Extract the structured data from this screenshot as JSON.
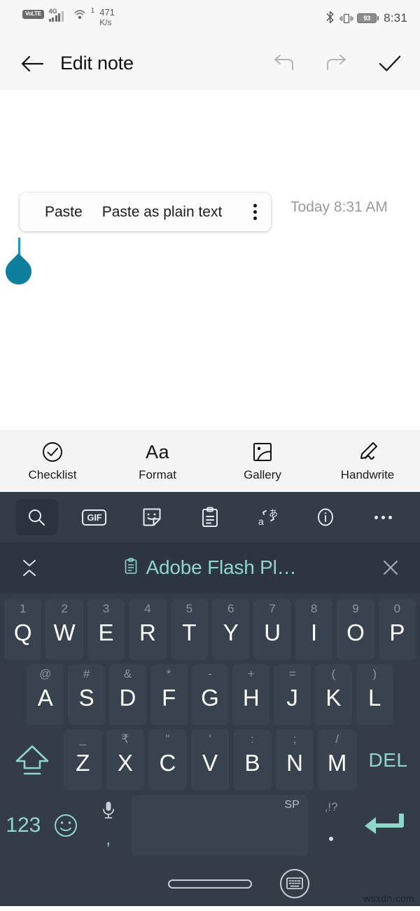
{
  "status_bar": {
    "volte": "VoLTE",
    "network_type": "4G",
    "hotspot_count": "1",
    "data_rate": "471",
    "data_rate_unit": "K/s",
    "bluetooth_icon": "bluetooth-icon",
    "vibrate_icon": "vibrate-icon",
    "battery_level": "93",
    "time": "8:31"
  },
  "app_bar": {
    "back_icon": "back-arrow-icon",
    "title": "Edit note",
    "undo_icon": "undo-icon",
    "redo_icon": "redo-icon",
    "done_icon": "checkmark-icon"
  },
  "editor": {
    "note_date": "Today 8:31 AM",
    "paste_menu": {
      "paste": "Paste",
      "paste_plain": "Paste as plain text",
      "overflow_icon": "more-vertical-icon"
    },
    "cursor_handle_color": "#0e7f9c",
    "caret_color": "#2196c4"
  },
  "format_toolbar": {
    "items": [
      {
        "label": "Checklist",
        "icon": "check-circle-icon"
      },
      {
        "label": "Format",
        "icon": "format-aa-icon",
        "glyph": "Aa"
      },
      {
        "label": "Gallery",
        "icon": "image-icon"
      },
      {
        "label": "Handwrite",
        "icon": "pencil-handwrite-icon"
      }
    ]
  },
  "keyboard": {
    "toolbar": [
      {
        "name": "search-icon",
        "label": "",
        "active": true
      },
      {
        "name": "gif-icon",
        "label": "GIF",
        "active": false
      },
      {
        "name": "sticker-icon",
        "label": "",
        "active": false
      },
      {
        "name": "clipboard-icon",
        "label": "",
        "active": false
      },
      {
        "name": "translate-icon",
        "label": "",
        "active": false
      },
      {
        "name": "info-icon",
        "label": "",
        "active": false
      },
      {
        "name": "more-horizontal-icon",
        "label": "",
        "active": false
      }
    ],
    "clipboard_suggestion": {
      "collapse_icon": "collapse-chevrons-icon",
      "clip_icon": "clipboard-small-icon",
      "text": "Adobe Flash Pl…",
      "close_icon": "close-icon",
      "accent_color": "#8fd6c8"
    },
    "row1": [
      {
        "main": "Q",
        "hint": "1"
      },
      {
        "main": "W",
        "hint": "2"
      },
      {
        "main": "E",
        "hint": "3"
      },
      {
        "main": "R",
        "hint": "4"
      },
      {
        "main": "T",
        "hint": "5"
      },
      {
        "main": "Y",
        "hint": "6"
      },
      {
        "main": "U",
        "hint": "7"
      },
      {
        "main": "I",
        "hint": "8"
      },
      {
        "main": "O",
        "hint": "9"
      },
      {
        "main": "P",
        "hint": "0"
      }
    ],
    "row2": [
      {
        "main": "A",
        "hint": "@"
      },
      {
        "main": "S",
        "hint": "#"
      },
      {
        "main": "D",
        "hint": "&"
      },
      {
        "main": "F",
        "hint": "*"
      },
      {
        "main": "G",
        "hint": "-"
      },
      {
        "main": "H",
        "hint": "+"
      },
      {
        "main": "J",
        "hint": "="
      },
      {
        "main": "K",
        "hint": "("
      },
      {
        "main": "L",
        "hint": ")"
      }
    ],
    "row3": [
      {
        "main": "Z",
        "hint": "_"
      },
      {
        "main": "X",
        "hint": "₹"
      },
      {
        "main": "C",
        "hint": "\""
      },
      {
        "main": "V",
        "hint": "'"
      },
      {
        "main": "B",
        "hint": ":"
      },
      {
        "main": "N",
        "hint": ";"
      },
      {
        "main": "M",
        "hint": "/"
      }
    ],
    "shift_icon": "shift-up-icon",
    "delete_label": "DEL",
    "bottom_row": {
      "numbers_label": "123",
      "emoji_icon": "emoji-smiley-icon",
      "mic_icon": "microphone-icon",
      "comma_label": ",",
      "space_label": "SP",
      "period_hint": ",!?",
      "period_label": ".",
      "enter_icon": "enter-arrow-icon"
    }
  },
  "nav_bar": {
    "home_pill": "home-pill",
    "hide_keyboard_icon": "hide-keyboard-icon",
    "watermark": "wsxdn.com"
  }
}
